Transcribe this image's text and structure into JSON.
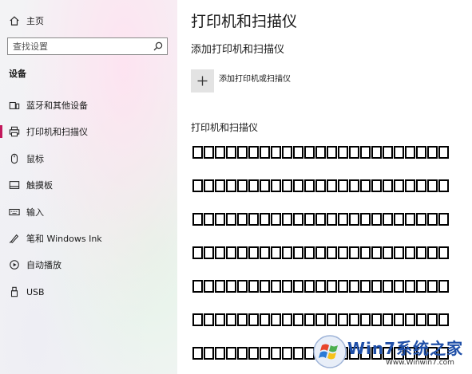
{
  "sidebar": {
    "home_label": "主页",
    "search_placeholder": "查找设置",
    "section_heading": "设备",
    "items": [
      {
        "label": "蓝牙和其他设备",
        "icon": "bluetooth-devices-icon"
      },
      {
        "label": "打印机和扫描仪",
        "icon": "printer-icon",
        "active": true
      },
      {
        "label": "鼠标",
        "icon": "mouse-icon"
      },
      {
        "label": "触摸板",
        "icon": "touchpad-icon"
      },
      {
        "label": "输入",
        "icon": "keyboard-icon"
      },
      {
        "label": "笔和 Windows Ink",
        "icon": "pen-icon"
      },
      {
        "label": "自动播放",
        "icon": "autoplay-icon"
      },
      {
        "label": "USB",
        "icon": "usb-icon"
      }
    ]
  },
  "main": {
    "title": "打印机和扫描仪",
    "add_heading": "添加打印机和扫描仪",
    "add_label": "添加打印机或扫描仪",
    "list_heading": "打印机和扫描仪",
    "tofu_rows": [
      "□□□□□□□□□□□□□□□□□□□□□□□",
      "□□□□□□□□□□□□□□□□□□□□□□□",
      "□□□□□□□□□□□□□□□□□□□□□□□",
      "□□□□□□□□□□□□□□□□□□□□□□□",
      "□□□□□□□□□□□□□□□□□□□□□□□",
      "□□□□□□□□□□□□□□□□□□□□□□□",
      "□□□□□□□□□□□□□□□□□□□□□□□"
    ]
  },
  "watermark": {
    "logo_text": "Win7系统之家",
    "url": "Www.Winwin7.com"
  },
  "colors": {
    "accent": "#c2185b",
    "watermark_blue": "#1f4fa8"
  }
}
